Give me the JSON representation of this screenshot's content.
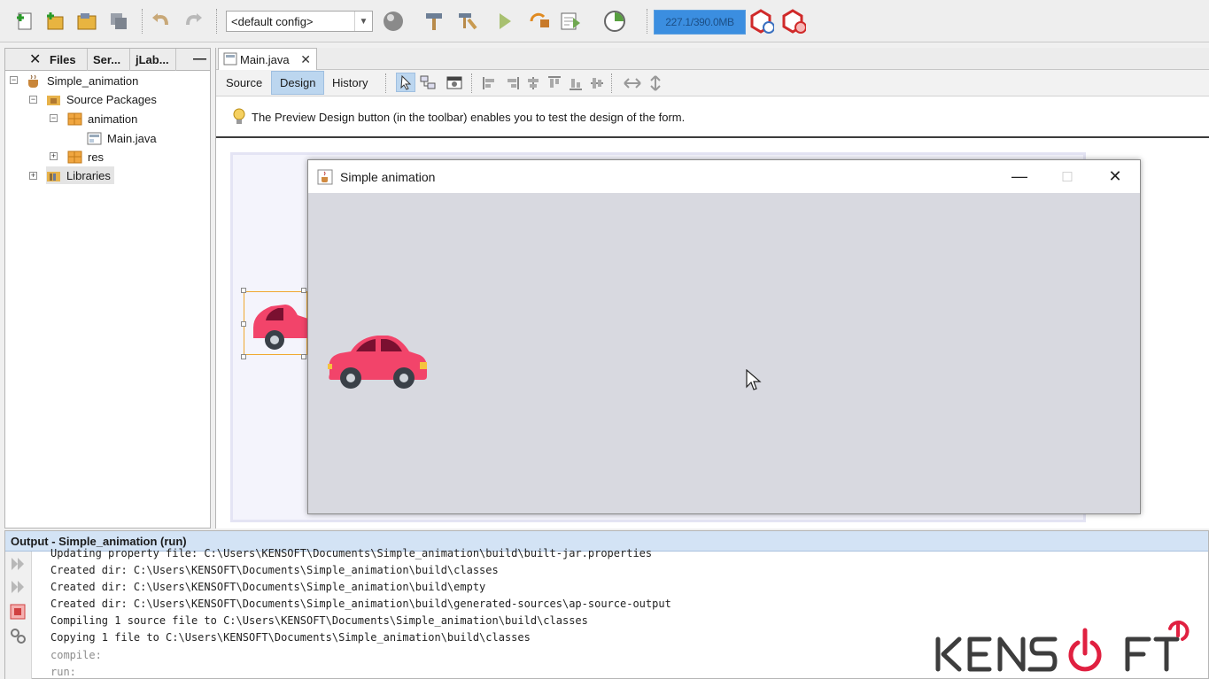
{
  "toolbar": {
    "config_value": "<default config>",
    "memory_text": "227.1/390.0MB",
    "icons": [
      "new-file-icon",
      "new-project-icon",
      "open-project-icon",
      "save-all-icon",
      "undo-icon",
      "redo-icon",
      "globe-icon",
      "build-hammer-icon",
      "clean-build-icon",
      "run-icon",
      "debug-icon",
      "profile-icon",
      "pause-io-icon",
      "gc-icon",
      "profiler-snapshot-icon"
    ]
  },
  "projects_panel": {
    "tabs": [
      "Files",
      "Ser...",
      "jLab..."
    ],
    "tree": [
      {
        "label": "Simple_animation",
        "icon": "coffee-cup-icon"
      },
      {
        "label": "Source Packages",
        "icon": "source-folder-icon"
      },
      {
        "label": "animation",
        "icon": "package-icon"
      },
      {
        "label": "Main.java",
        "icon": "java-form-file-icon"
      },
      {
        "label": "res",
        "icon": "package-icon"
      },
      {
        "label": "Libraries",
        "icon": "libraries-folder-icon"
      }
    ]
  },
  "editor": {
    "file_tab": "Main.java",
    "modes": [
      "Source",
      "Design",
      "History"
    ],
    "active_mode": "Design",
    "hint": "The Preview Design button (in the toolbar) enables you to test the design of the form."
  },
  "preview_window": {
    "title": "Simple animation"
  },
  "output": {
    "title": "Output - Simple_animation (run)",
    "lines": [
      "Updating property file: C:\\Users\\KENSOFT\\Documents\\Simple_animation\\build\\built-jar.properties",
      "Created dir: C:\\Users\\KENSOFT\\Documents\\Simple_animation\\build\\classes",
      "Created dir: C:\\Users\\KENSOFT\\Documents\\Simple_animation\\build\\empty",
      "Created dir: C:\\Users\\KENSOFT\\Documents\\Simple_animation\\build\\generated-sources\\ap-source-output",
      "Compiling 1 source file to C:\\Users\\KENSOFT\\Documents\\Simple_animation\\build\\classes",
      "Copying 1 file to C:\\Users\\KENSOFT\\Documents\\Simple_animation\\build\\classes",
      "compile:",
      "run:"
    ]
  },
  "watermark": {
    "text": "KENSOFT"
  },
  "colors": {
    "car_body": "#f2446a",
    "car_window": "#7a1030",
    "accent_blue": "#3b8ee0",
    "output_header": "#d3e3f5"
  }
}
